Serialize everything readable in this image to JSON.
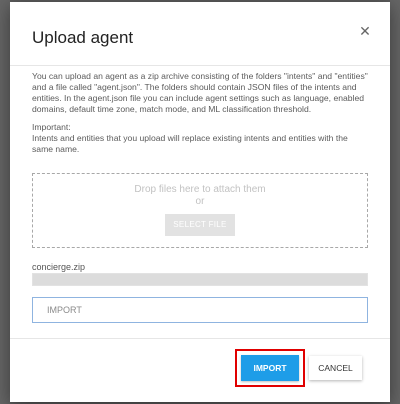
{
  "dialog": {
    "title": "Upload agent",
    "close_icon": "close-icon",
    "description": "You can upload an agent as a zip archive consisting of the folders \"intents\" and \"entities\" and a file called \"agent.json\". The folders should contain JSON files of the intents and entities. In the agent.json file you can include agent settings such as language, enabled domains, default time zone, match mode, and ML classification threshold.",
    "important_label": "Important:",
    "important_text": "Intents and entities that you upload will replace existing intents and entities with the same name.",
    "dropzone": {
      "text": "Drop files here to attach them",
      "or": "or",
      "select_file_label": "SELECT FILE"
    },
    "file": {
      "name": "concierge.zip"
    },
    "import_field_value": "IMPORT",
    "footer": {
      "import_label": "IMPORT",
      "cancel_label": "CANCEL"
    }
  },
  "colors": {
    "primary": "#1e9de8",
    "highlight": "#e00000",
    "overlay": "#5e5e5e"
  }
}
